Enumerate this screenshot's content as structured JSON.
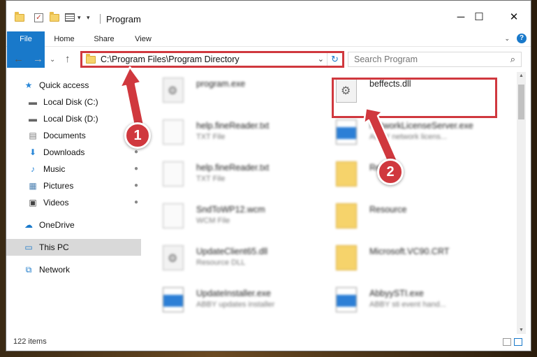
{
  "window": {
    "title": "Program",
    "controls": {
      "minimize": "─",
      "maximize": "☐",
      "close": "✕"
    }
  },
  "ribbon": {
    "tabs": [
      "File",
      "Home",
      "Share",
      "View"
    ],
    "expand": "⌄",
    "help": "?"
  },
  "address_bar": {
    "path": "C:\\Program Files\\Program Directory",
    "dropdown": "⌄",
    "refresh": "↻"
  },
  "search": {
    "placeholder": "Search Program",
    "icon": "search-icon"
  },
  "nav_buttons": {
    "back": "←",
    "forward": "→",
    "recent": "⌄",
    "up": "↑"
  },
  "nav_pane": {
    "items": [
      {
        "label": "Quick access",
        "icon": "★",
        "pinned": false
      },
      {
        "label": "Local Disk (C:)",
        "icon": "▬",
        "pinned": true
      },
      {
        "label": "Local Disk (D:)",
        "icon": "▬",
        "pinned": true
      },
      {
        "label": "Documents",
        "icon": "▤",
        "pinned": true
      },
      {
        "label": "Downloads",
        "icon": "⬇",
        "pinned": true
      },
      {
        "label": "Music",
        "icon": "♪",
        "pinned": true
      },
      {
        "label": "Pictures",
        "icon": "▦",
        "pinned": true
      },
      {
        "label": "Videos",
        "icon": "▣",
        "pinned": true
      },
      {
        "label": "OneDrive",
        "icon": "☁",
        "pinned": false
      },
      {
        "label": "This PC",
        "icon": "▭",
        "pinned": false
      },
      {
        "label": "Network",
        "icon": "⧉",
        "pinned": false
      }
    ],
    "pin_icon": "📌"
  },
  "files": {
    "left": [
      {
        "name": "program.exe",
        "type": ""
      },
      {
        "name": "help.fineReader.txt",
        "type": "TXT File"
      },
      {
        "name": "help.fineReader.txt",
        "type": "TXT File"
      },
      {
        "name": "SndToWP12.wcm",
        "type": "WCM File"
      },
      {
        "name": "UpdateClient65.dll",
        "type": "Resource DLL"
      },
      {
        "name": "UpdateInstaller.exe",
        "type": "ABBY updates installer"
      }
    ],
    "right": [
      {
        "name": "beffects.dll",
        "type": ""
      },
      {
        "name": "NetworkLicenseServer.exe",
        "type": "ABBY network licens..."
      },
      {
        "name": "Re",
        "type": ""
      },
      {
        "name": "Resource",
        "type": ""
      },
      {
        "name": "Microsoft.VC90.CRT",
        "type": ""
      },
      {
        "name": "AbbyySTI.exe",
        "type": "ABBY sti event hand..."
      }
    ]
  },
  "status": {
    "item_count": "122 items"
  },
  "callouts": {
    "first": "1",
    "second": "2"
  },
  "colors": {
    "accent": "#1979ca",
    "callout": "#d0383e"
  }
}
